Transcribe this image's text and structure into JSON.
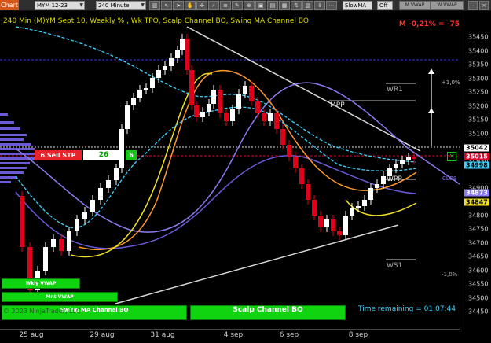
{
  "toolbar": {
    "chart_tab": "Chart",
    "instrument": "MYM 12-23",
    "interval": "240 Minute",
    "ma_selector": "SlowMA",
    "toggle": "Off",
    "btn_mvwap": "M VWAP",
    "btn_wvwap": "W VWAP"
  },
  "chart": {
    "title": "240 Min (M)YM Sept 10, Weekly % , Wk TPO, Scalp Channel BO, Swing MA Channel BO",
    "performance": "M -0,21% = -75",
    "sell_signal": {
      "label": "6 Sell STP",
      "value": "26",
      "count": "6"
    },
    "labels": {
      "mpp": "MPP",
      "wpp": "WPP",
      "wr1": "WR1",
      "ws1": "WS1",
      "clos": "CLOS"
    },
    "pct_up": "+1,0%",
    "pct_down": "-1,0%",
    "wkly_vwap": "Wkly VWAP",
    "mnt_vwap": "Mnt VWAP",
    "swing_ma": "Swing MA Channel BO",
    "scalp_channel": "Scalp Channel BO",
    "time_remaining": "Time remaining = 01:07:44",
    "copyright": "© 2023 NinjaTrader, LLC",
    "colors": {
      "up": "#ffffff",
      "down": "#e0001b",
      "cyan_band": "#3fd2ff",
      "purple_ma": "#8a7cf0",
      "orange_ma": "#ff9a2a",
      "yellow_ma": "#f0e020",
      "trendline": "#d8d8d8",
      "label_green": "#11d411"
    }
  },
  "axis": {
    "y_ticks": [
      "35450",
      "35400",
      "35350",
      "35300",
      "35250",
      "35200",
      "35150",
      "35100",
      "35050",
      "34950",
      "34900",
      "34850",
      "34800",
      "34750",
      "34700",
      "34650",
      "34600",
      "34550",
      "34500",
      "34450"
    ],
    "x_ticks": [
      "25 aug",
      "29 aug",
      "31 aug",
      "4 sep",
      "6 sep",
      "8 sep"
    ],
    "price_boxes": {
      "p35042": "35042",
      "p35015": "35015",
      "p34998": "34998",
      "p34873": "34873",
      "p34847": "34847"
    }
  },
  "chart_data": {
    "type": "candlestick",
    "y_range": [
      34425,
      35475
    ],
    "x_labels": [
      "25 aug",
      "29 aug",
      "31 aug",
      "4 sep",
      "6 sep",
      "8 sep"
    ],
    "levels": {
      "current": 35042,
      "sell_stop": 35015,
      "clos": 34998,
      "level_2": 34873,
      "level_3": 34847
    }
  }
}
